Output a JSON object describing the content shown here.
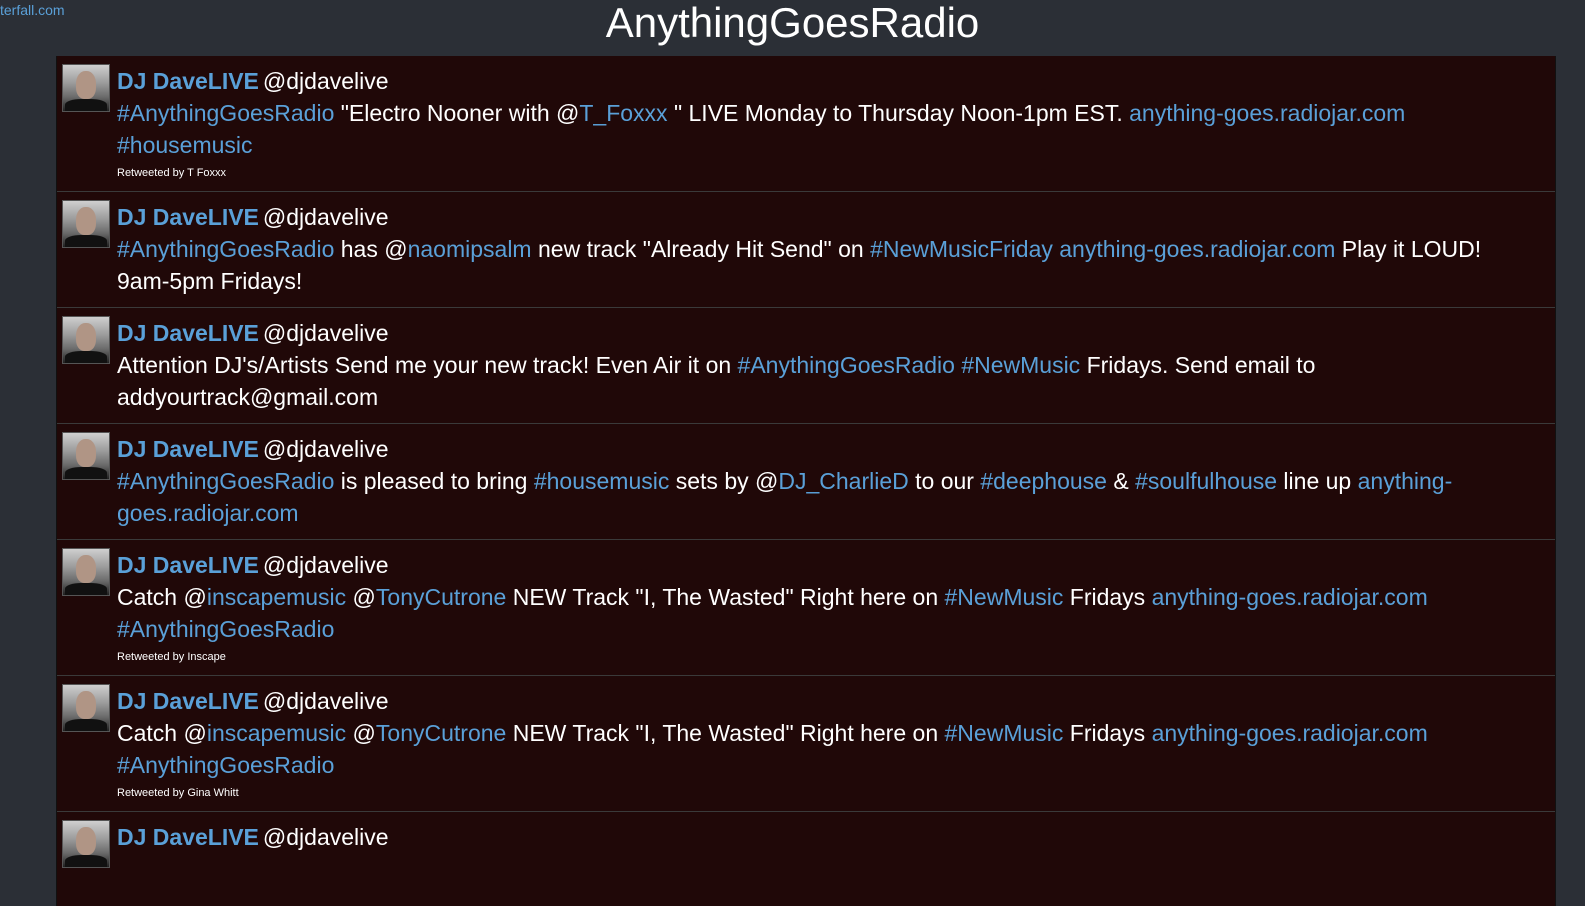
{
  "corner_link": "terfall.com",
  "page_title": "AnythingGoesRadio",
  "tweets": [
    {
      "author": "DJ DaveLIVE",
      "handle": "@djdavelive",
      "parts": [
        {
          "t": "#AnythingGoesRadio",
          "link": true
        },
        {
          "t": " \"Electro Nooner with @",
          "link": false
        },
        {
          "t": "T_Foxxx",
          "link": true
        },
        {
          "t": " \" LIVE Monday to Thursday Noon-1pm EST. ",
          "link": false
        },
        {
          "t": "anything-goes.radiojar.com",
          "link": true
        },
        {
          "t": " ",
          "link": false
        },
        {
          "t": "#housemusic",
          "link": true
        }
      ],
      "retweeted_by": "Retweeted by T Foxxx"
    },
    {
      "author": "DJ DaveLIVE",
      "handle": "@djdavelive",
      "parts": [
        {
          "t": "#AnythingGoesRadio",
          "link": true
        },
        {
          "t": " has @",
          "link": false
        },
        {
          "t": "naomipsalm",
          "link": true
        },
        {
          "t": " new track \"Already Hit Send\" on ",
          "link": false
        },
        {
          "t": "#NewMusicFriday",
          "link": true
        },
        {
          "t": " ",
          "link": false
        },
        {
          "t": "anything-goes.radiojar.com",
          "link": true
        },
        {
          "t": " Play it LOUD! 9am-5pm Fridays!",
          "link": false
        }
      ],
      "retweeted_by": ""
    },
    {
      "author": "DJ DaveLIVE",
      "handle": "@djdavelive",
      "parts": [
        {
          "t": "Attention DJ's/Artists Send me your new track! Even Air it on ",
          "link": false
        },
        {
          "t": "#AnythingGoesRadio",
          "link": true
        },
        {
          "t": " ",
          "link": false
        },
        {
          "t": "#NewMusic",
          "link": true
        },
        {
          "t": " Fridays. Send email to addyourtrack@gmail.com",
          "link": false
        }
      ],
      "retweeted_by": ""
    },
    {
      "author": "DJ DaveLIVE",
      "handle": "@djdavelive",
      "parts": [
        {
          "t": "#AnythingGoesRadio",
          "link": true
        },
        {
          "t": " is pleased to bring ",
          "link": false
        },
        {
          "t": "#housemusic",
          "link": true
        },
        {
          "t": " sets by @",
          "link": false
        },
        {
          "t": "DJ_CharlieD",
          "link": true
        },
        {
          "t": " to our ",
          "link": false
        },
        {
          "t": "#deephouse",
          "link": true
        },
        {
          "t": " & ",
          "link": false
        },
        {
          "t": "#soulfulhouse",
          "link": true
        },
        {
          "t": " line up ",
          "link": false
        },
        {
          "t": "anything-goes.radiojar.com",
          "link": true
        }
      ],
      "retweeted_by": ""
    },
    {
      "author": "DJ DaveLIVE",
      "handle": "@djdavelive",
      "parts": [
        {
          "t": "Catch @",
          "link": false
        },
        {
          "t": "inscapemusic",
          "link": true
        },
        {
          "t": " @",
          "link": false
        },
        {
          "t": "TonyCutrone",
          "link": true
        },
        {
          "t": " NEW Track \"I, The Wasted\" Right here on ",
          "link": false
        },
        {
          "t": "#NewMusic",
          "link": true
        },
        {
          "t": " Fridays ",
          "link": false
        },
        {
          "t": "anything-goes.radiojar.com",
          "link": true
        },
        {
          "t": " ",
          "link": false
        },
        {
          "t": "#AnythingGoesRadio",
          "link": true
        }
      ],
      "retweeted_by": "Retweeted by Inscape"
    },
    {
      "author": "DJ DaveLIVE",
      "handle": "@djdavelive",
      "parts": [
        {
          "t": "Catch @",
          "link": false
        },
        {
          "t": "inscapemusic",
          "link": true
        },
        {
          "t": " @",
          "link": false
        },
        {
          "t": "TonyCutrone",
          "link": true
        },
        {
          "t": " NEW Track \"I, The Wasted\" Right here on ",
          "link": false
        },
        {
          "t": "#NewMusic",
          "link": true
        },
        {
          "t": " Fridays ",
          "link": false
        },
        {
          "t": "anything-goes.radiojar.com",
          "link": true
        },
        {
          "t": " ",
          "link": false
        },
        {
          "t": "#AnythingGoesRadio",
          "link": true
        }
      ],
      "retweeted_by": "Retweeted by Gina Whitt"
    },
    {
      "author": "DJ DaveLIVE",
      "handle": "@djdavelive",
      "parts": [],
      "retweeted_by": ""
    }
  ]
}
